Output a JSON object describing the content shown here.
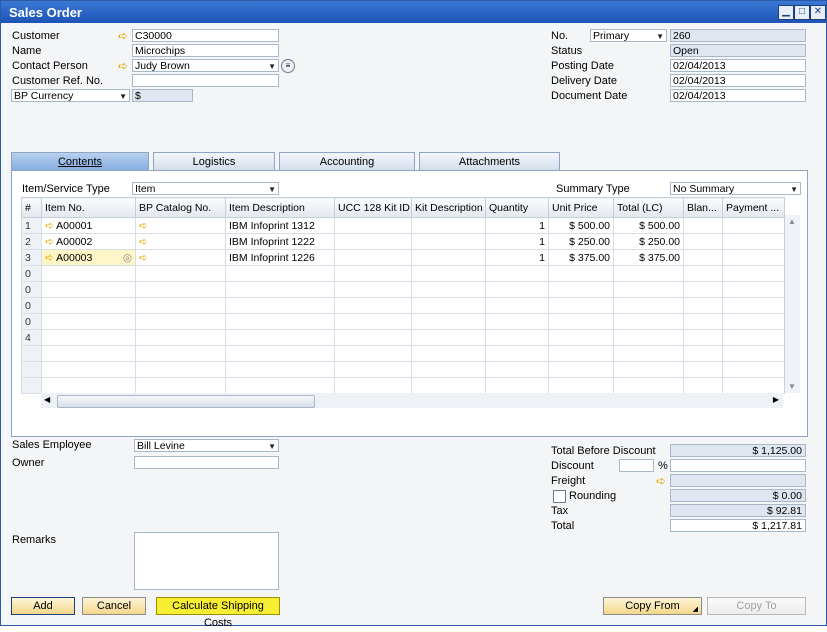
{
  "window": {
    "title": "Sales Order"
  },
  "header_left": {
    "customer": {
      "label": "Customer",
      "value": "C30000"
    },
    "name": {
      "label": "Name",
      "value": "Microchips"
    },
    "contact_person": {
      "label": "Contact Person",
      "value": "Judy Brown"
    },
    "customer_ref": {
      "label": "Customer Ref. No.",
      "value": ""
    },
    "currency": {
      "label": "BP Currency",
      "value": "$"
    }
  },
  "header_right": {
    "no": {
      "label": "No.",
      "series": "Primary",
      "value": "260"
    },
    "status": {
      "label": "Status",
      "value": "Open"
    },
    "posting_date": {
      "label": "Posting Date",
      "value": "02/04/2013"
    },
    "delivery_date": {
      "label": "Delivery Date",
      "value": "02/04/2013"
    },
    "document_date": {
      "label": "Document Date",
      "value": "02/04/2013"
    }
  },
  "tabs": [
    {
      "label": "Contents",
      "active": true
    },
    {
      "label": "Logistics"
    },
    {
      "label": "Accounting"
    },
    {
      "label": "Attachments"
    }
  ],
  "contents": {
    "item_type_label": "Item/Service Type",
    "item_type_value": "Item",
    "summary_type_label": "Summary Type",
    "summary_type_value": "No Summary",
    "columns": [
      "#",
      "Item No.",
      "BP Catalog No.",
      "Item Description",
      "UCC 128 Kit ID",
      "Kit Description",
      "Quantity",
      "Unit Price",
      "Total (LC)",
      "Blan...",
      "Payment ..."
    ],
    "rows": [
      {
        "n": "1",
        "item_no": "A00001",
        "desc": "IBM Infoprint 1312",
        "qty": "1",
        "price": "$ 500.00",
        "total": "$ 500.00"
      },
      {
        "n": "2",
        "item_no": "A00002",
        "desc": "IBM Infoprint 1222",
        "qty": "1",
        "price": "$ 250.00",
        "total": "$ 250.00"
      },
      {
        "n": "3",
        "item_no": "A00003",
        "desc": "IBM Infoprint 1226",
        "qty": "1",
        "price": "$ 375.00",
        "total": "$ 375.00"
      }
    ],
    "empty_row_numbers": [
      "0",
      "0",
      "0",
      "0",
      "4",
      "",
      "",
      ""
    ]
  },
  "footer_left": {
    "sales_employee": {
      "label": "Sales Employee",
      "value": "Bill Levine"
    },
    "owner": {
      "label": "Owner",
      "value": ""
    },
    "remarks": {
      "label": "Remarks",
      "value": ""
    }
  },
  "totals": {
    "before_discount": {
      "label": "Total Before Discount",
      "value": "$ 1,125.00"
    },
    "discount": {
      "label": "Discount",
      "percent": "",
      "percent_sign": "%",
      "value": ""
    },
    "freight": {
      "label": "Freight",
      "value": ""
    },
    "rounding": {
      "label": "Rounding",
      "value": "$ 0.00"
    },
    "tax": {
      "label": "Tax",
      "value": "$ 92.81"
    },
    "total": {
      "label": "Total",
      "value": "$ 1,217.81"
    }
  },
  "buttons": {
    "add": "Add",
    "cancel": "Cancel",
    "shipping": "Calculate Shipping Costs",
    "copy_from": "Copy From",
    "copy_to": "Copy To"
  },
  "colors": {
    "titlebar": "#1c54b6",
    "active_tab": "#86aee0",
    "link_arrow": "#e3a800",
    "shipping_button": "#f7ee33"
  }
}
